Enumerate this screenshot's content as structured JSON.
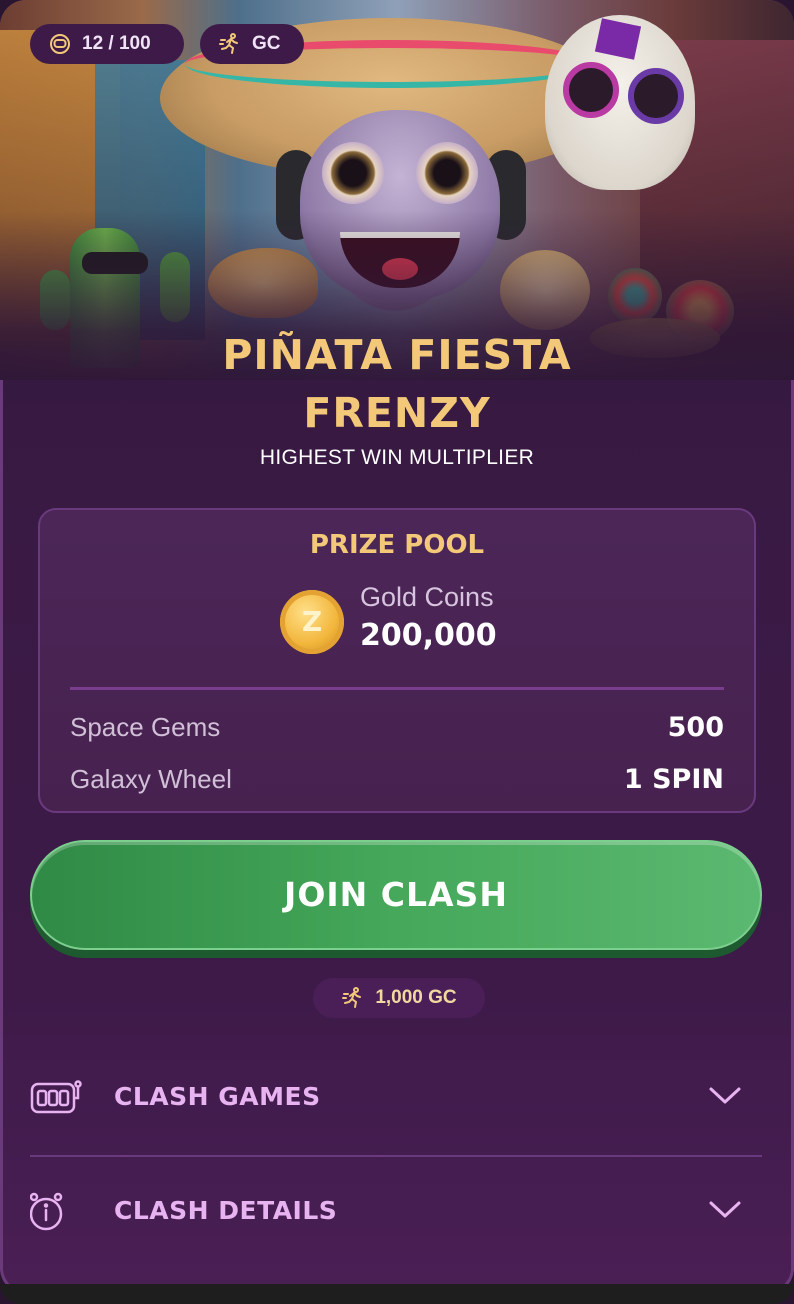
{
  "header": {
    "players_count": "12 / 100",
    "currency_tag": "GC"
  },
  "event": {
    "title_line1": "PIÑATA FIESTA",
    "title_line2": "FRENZY",
    "subtitle": "HIGHEST WIN MULTIPLIER"
  },
  "prize_pool": {
    "title": "PRIZE POOL",
    "coin_letter": "Z",
    "main_label": "Gold Coins",
    "main_value": "200,000",
    "rows": [
      {
        "label": "Space Gems",
        "value": "500"
      },
      {
        "label": "Galaxy Wheel",
        "value": "1 SPIN"
      }
    ]
  },
  "join": {
    "button_label": "JOIN CLASH",
    "entry_cost": "1,000 GC"
  },
  "sections": [
    {
      "label": "CLASH GAMES",
      "icon": "slot-machine-icon"
    },
    {
      "label": "CLASH DETAILS",
      "icon": "alarm-clock-info-icon"
    }
  ],
  "colors": {
    "accent_gold": "#f3c979",
    "accent_pink": "#e7b3f0",
    "join_green": "#45a85a",
    "card_bg": "#3a1a45"
  }
}
